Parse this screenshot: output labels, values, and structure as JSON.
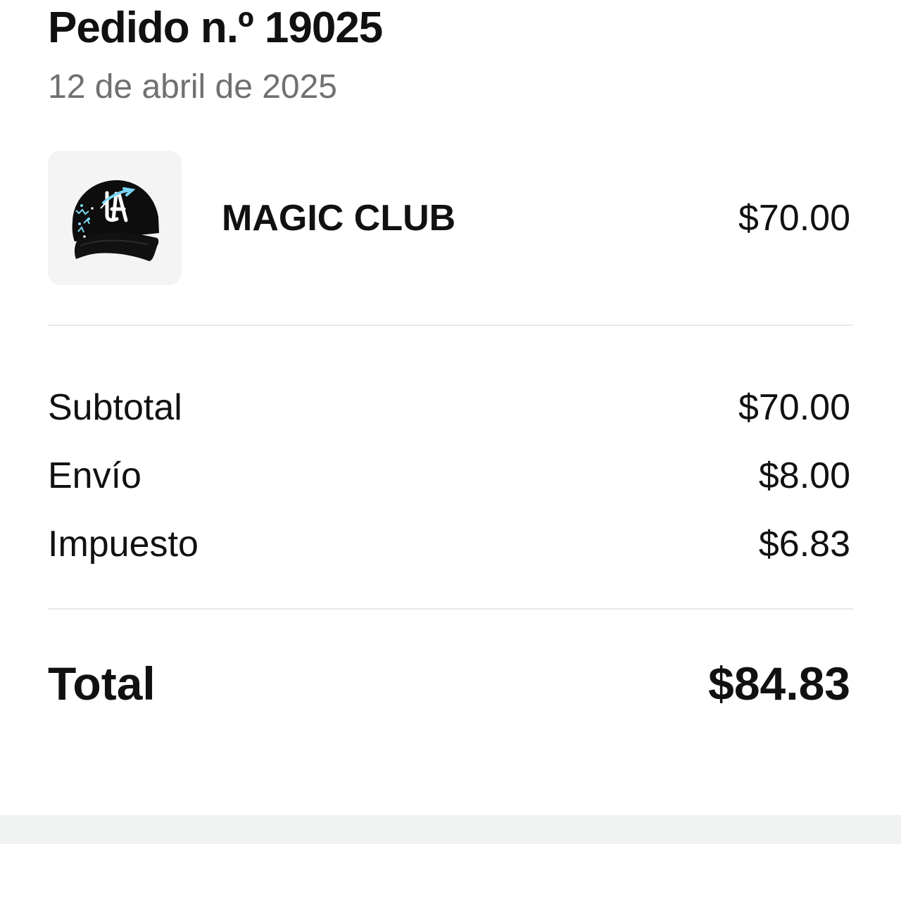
{
  "order": {
    "title": "Pedido n.º 19025",
    "date": "12 de abril de 2025"
  },
  "item": {
    "name": "MAGIC CLUB",
    "price": "$70.00",
    "thumbnail_icon": "cap-product-image"
  },
  "summary": {
    "subtotal_label": "Subtotal",
    "subtotal_value": "$70.00",
    "shipping_label": "Envío",
    "shipping_value": "$8.00",
    "tax_label": "Impuesto",
    "tax_value": "$6.83",
    "total_label": "Total",
    "total_value": "$84.83"
  },
  "colors": {
    "background": "#ffffff",
    "text": "#111111",
    "muted_text": "#707070",
    "divider": "#e9e9e9",
    "thumb_background": "#f4f4f4",
    "bottom_band": "#f0f2f2"
  }
}
